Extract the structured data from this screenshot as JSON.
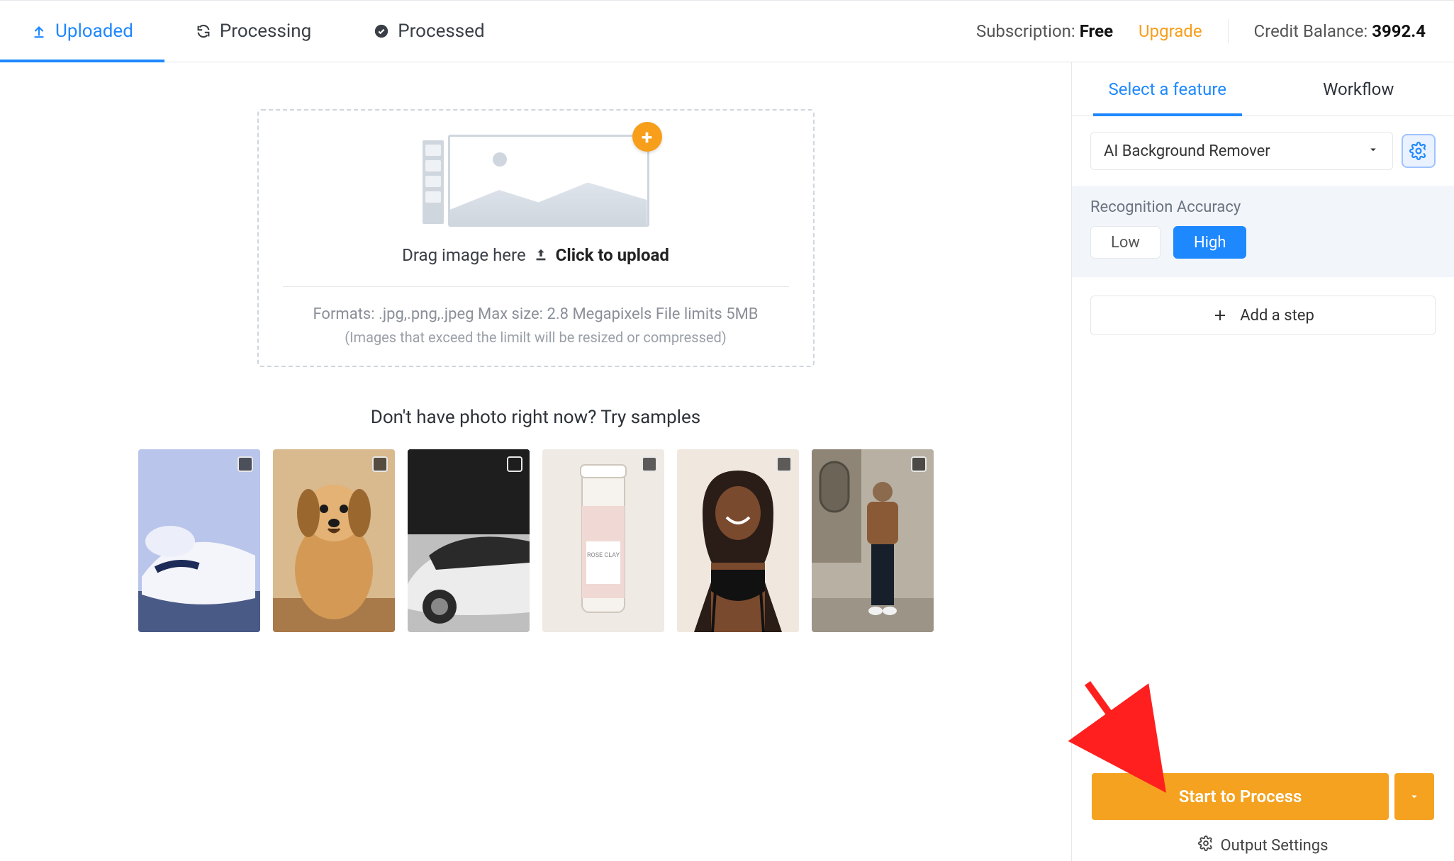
{
  "tabs": {
    "uploaded": "Uploaded",
    "processing": "Processing",
    "processed": "Processed"
  },
  "header": {
    "subscription_label": "Subscription:",
    "subscription_value": "Free",
    "upgrade": "Upgrade",
    "credit_label": "Credit Balance:",
    "credit_value": "3992.4"
  },
  "dropzone": {
    "drag_text": "Drag image here",
    "click_text": "Click to upload",
    "formats": "Formats: .jpg,.png,.jpeg Max size: 2.8 Megapixels File limits 5MB",
    "note": "(Images that exceed the limilt will be resized or compressed)"
  },
  "samples": {
    "title": "Don't have photo right now? Try samples"
  },
  "right": {
    "tabs": {
      "feature": "Select a feature",
      "workflow": "Workflow"
    },
    "feature_selected": "AI Background Remover",
    "accuracy_label": "Recognition Accuracy",
    "accuracy": {
      "low": "Low",
      "high": "High"
    },
    "add_step": "Add a step",
    "process": "Start to Process",
    "output_settings": "Output Settings"
  }
}
